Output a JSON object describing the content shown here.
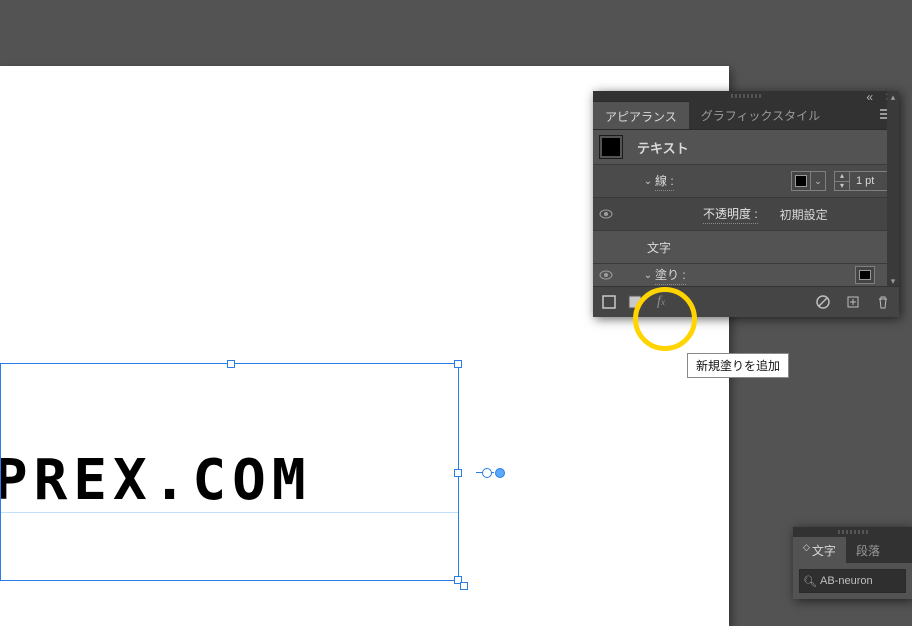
{
  "canvas": {
    "text": "TAKAPREX.COM"
  },
  "appearance_panel": {
    "tabs": {
      "appearance": "アピアランス",
      "graphic_styles": "グラフィックスタイル"
    },
    "title": "テキスト",
    "stroke_label": "線 :",
    "stroke_weight": "1 pt",
    "opacity_label": "不透明度 :",
    "opacity_value": "初期設定",
    "character_label": "文字",
    "fill_label": "塗り :",
    "tooltip_add_fill": "新規塗りを追加"
  },
  "char_panel": {
    "tab_character": "文字",
    "tab_paragraph": "段落",
    "font_value": "AB-neuron"
  }
}
